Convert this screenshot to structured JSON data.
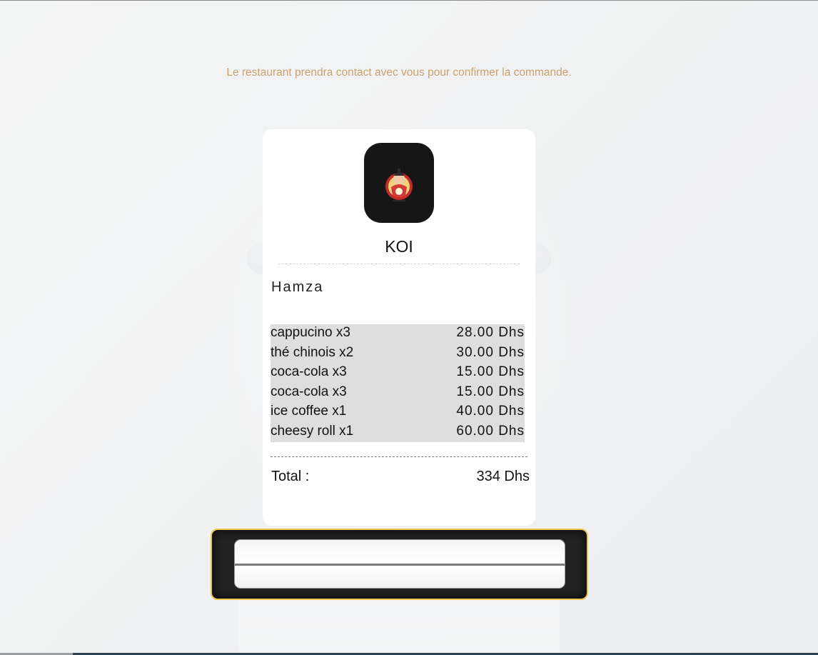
{
  "notice": "Le restaurant prendra contact avec vous pour confirmer la commande.",
  "receipt": {
    "restaurant_name": "KOI",
    "customer_name": "Hamza",
    "items": [
      {
        "name": "cappucino x3",
        "price": "28.00 Dhs"
      },
      {
        "name": "thé chinois x2",
        "price": "30.00 Dhs"
      },
      {
        "name": "coca-cola x3",
        "price": "15.00 Dhs"
      },
      {
        "name": "coca-cola x3",
        "price": "15.00 Dhs"
      },
      {
        "name": "ice coffee x1",
        "price": "40.00 Dhs"
      },
      {
        "name": "cheesy roll x1",
        "price": "60.00 Dhs"
      }
    ],
    "total_label": "Total :",
    "total_value": "334 Dhs"
  },
  "colors": {
    "notice_text": "#c9a06c",
    "printer_border": "#f3c24a",
    "printer_body": "#222222",
    "items_background": "#dedede"
  },
  "icons": {
    "logo": "chef-mascot-logo"
  }
}
